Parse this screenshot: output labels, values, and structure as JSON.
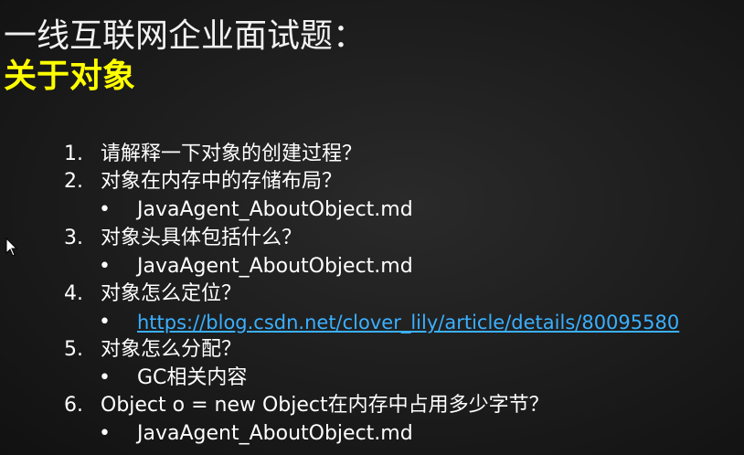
{
  "title": {
    "line1": "一线互联网企业面试题：",
    "line2": "关于对象"
  },
  "questions": [
    {
      "num": "1.",
      "text": "请解释一下对象的创建过程？",
      "sub": null
    },
    {
      "num": "2.",
      "text": "对象在内存中的存储布局？",
      "sub": "JavaAgent_AboutObject.md"
    },
    {
      "num": "3.",
      "text": "对象头具体包括什么？",
      "sub": "JavaAgent_AboutObject.md"
    },
    {
      "num": "4.",
      "text": "对象怎么定位？",
      "sub": "https://blog.csdn.net/clover_lily/article/details/80095580"
    },
    {
      "num": "5.",
      "text": "对象怎么分配？",
      "sub": "GC相关内容"
    },
    {
      "num": "6.",
      "text": "Object o = new Object在内存中占用多少字节？",
      "sub": "JavaAgent_AboutObject.md"
    }
  ],
  "bullet_char": "•",
  "colors": {
    "title_white": "#f2f2f2",
    "title_yellow": "#ffff00",
    "link": "#3ab0ff"
  }
}
